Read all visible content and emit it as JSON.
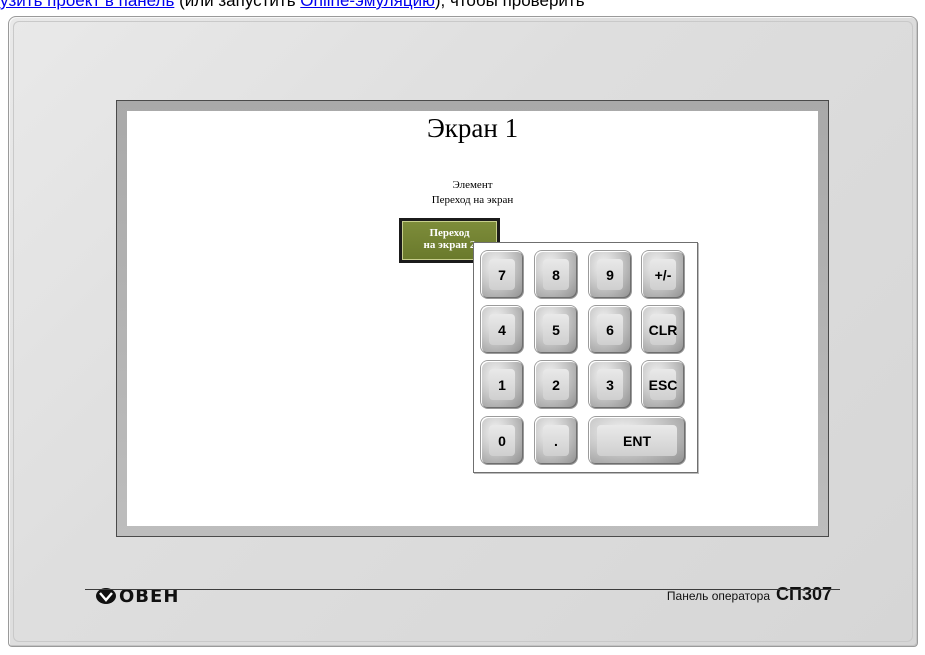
{
  "doc": {
    "link1": "узить проект в панель",
    "text1": " (или запустить ",
    "link2": "Online-эмуляцию",
    "text2": "), чтобы проверить"
  },
  "screen": {
    "title": "Экран 1",
    "element_label_line1": "Элемент",
    "element_label_line2": "Переход на экран",
    "goto_button_line1": "Переход",
    "goto_button_line2": "на экран 2"
  },
  "keypad": {
    "keys": [
      "7",
      "8",
      "9",
      "+/-",
      "4",
      "5",
      "6",
      "CLR",
      "1",
      "2",
      "3",
      "ESC",
      "0",
      ".",
      "ENT"
    ]
  },
  "footer": {
    "logo": "ОВЕН",
    "caption": "Панель оператора",
    "model": "СП307"
  },
  "colors": {
    "housing": "#dedede",
    "button_green": "#6f7e2f",
    "link": "#0000ee"
  }
}
